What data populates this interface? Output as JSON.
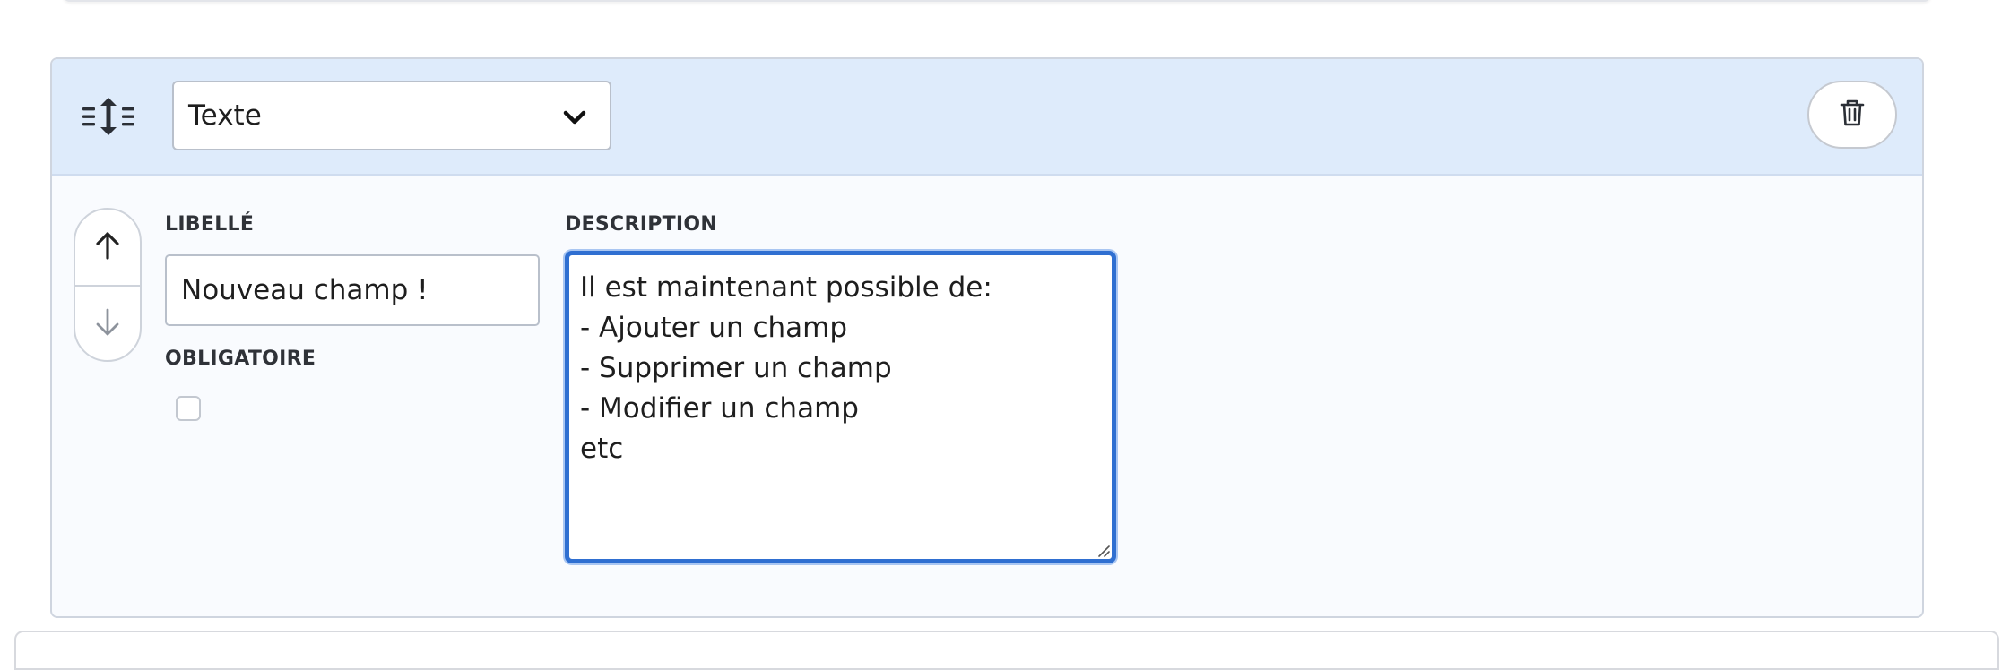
{
  "field": {
    "type_select": {
      "value": "Texte",
      "icon": "chevron-down-icon"
    },
    "drag_icon": "line-height-drag-icon",
    "delete_icon": "trash-icon",
    "move_up_icon": "arrow-up-icon",
    "move_down_icon": "arrow-down-icon",
    "libelle": {
      "label": "LIBELLÉ",
      "value": "Nouveau champ !"
    },
    "obligatoire": {
      "label": "OBLIGATOIRE",
      "checked": false
    },
    "description": {
      "label": "DESCRIPTION",
      "value": "Il est maintenant possible de:\n- Ajouter un champ\n- Supprimer un champ\n- Modifier un champ\netc"
    }
  },
  "colors": {
    "header_background": "#deebfb",
    "card_background": "#f9fbfe",
    "focus_border": "#2f6fd1"
  }
}
